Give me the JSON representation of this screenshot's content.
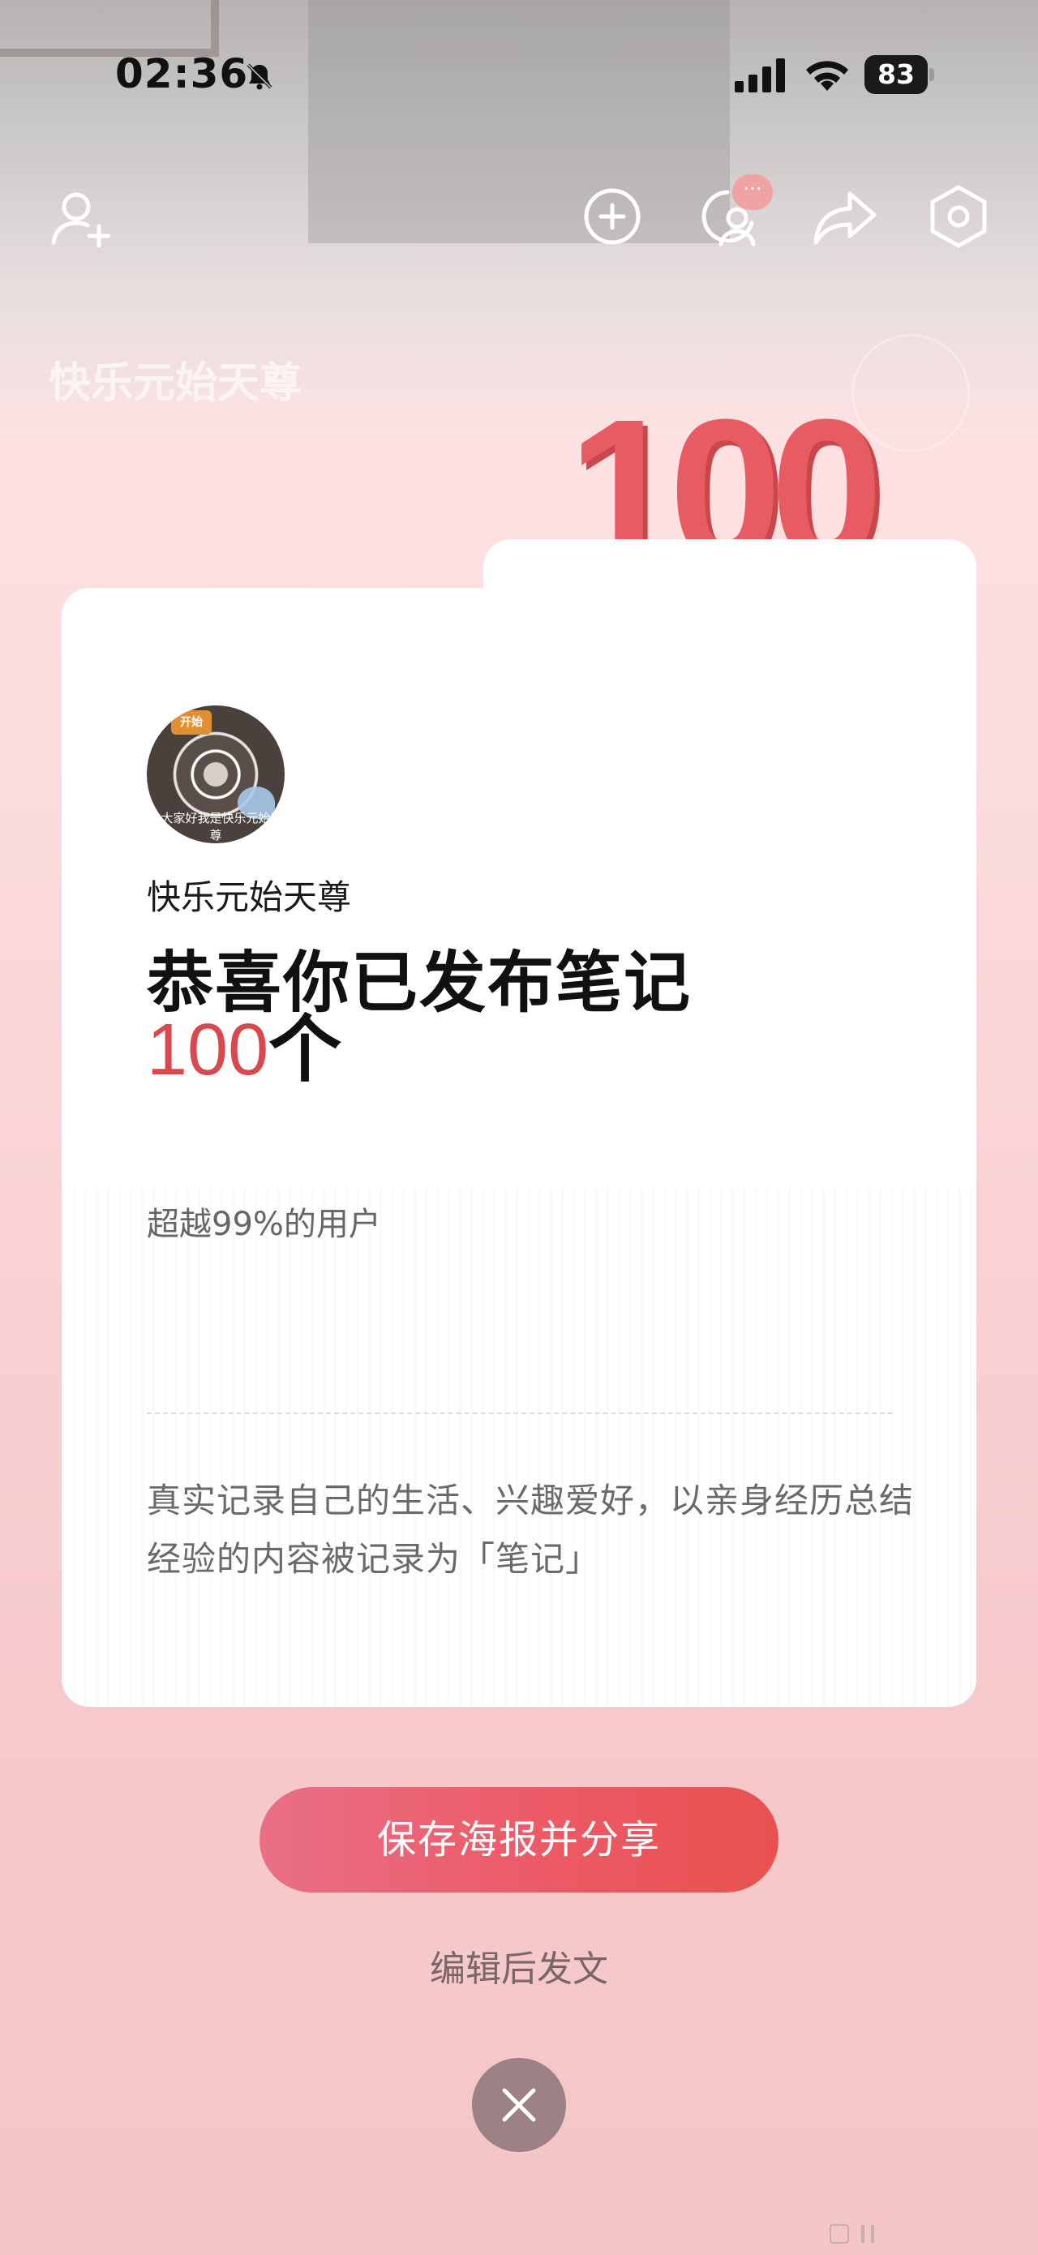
{
  "status_bar": {
    "time": "02:36",
    "battery": "83",
    "icons": [
      "bell-off-icon",
      "signal-icon",
      "wifi-icon",
      "battery-icon"
    ]
  },
  "top_bar": {
    "icons": [
      "add-friend-icon",
      "plus-circle-icon",
      "profile-visitors-icon",
      "share-icon",
      "settings-icon"
    ],
    "visitors_badge": "···"
  },
  "background": {
    "profile_name": "快乐元始天尊"
  },
  "badge": {
    "number": "100"
  },
  "card": {
    "avatar_caption": "@大家好我是快乐元始天尊",
    "avatar_tag": "开始",
    "username": "快乐元始天尊",
    "headline": "恭喜你已发布笔记",
    "count_number": "100",
    "count_unit": "个",
    "subtitle": "超越99%的用户",
    "description": "真实记录自己的生活、兴趣爱好，以亲身经历总结经验的内容被记录为「笔记」"
  },
  "actions": {
    "primary_label": "保存海报并分享",
    "secondary_label": "编辑后发文",
    "close_icon": "close-icon"
  },
  "colors": {
    "accent_red": "#d8484d",
    "button_gradient_start": "#ea6f86",
    "button_gradient_end": "#e8514f",
    "page_background": "#fbd9da"
  }
}
